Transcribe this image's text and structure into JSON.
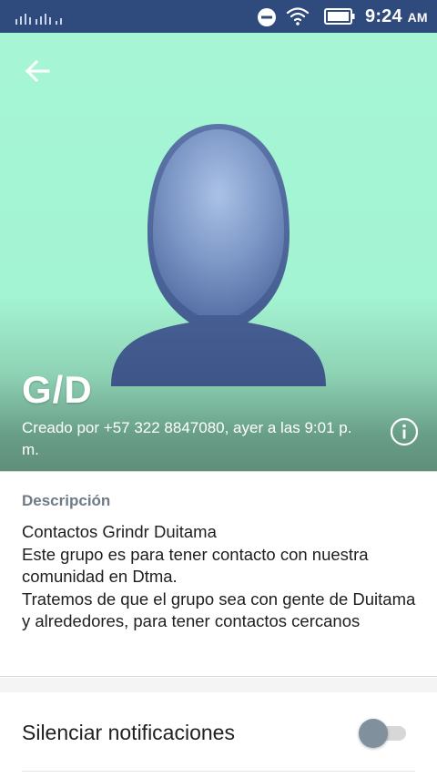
{
  "status_bar": {
    "time": "9:24",
    "ampm": "AM",
    "icons": [
      "signal-icon",
      "do-not-disturb-icon",
      "wifi-icon",
      "battery-icon"
    ]
  },
  "header": {
    "back_icon": "arrow-left-icon",
    "avatar_icon": "person-silhouette-icon",
    "group_name": "G/D",
    "created_by": "Creado por +57 322 8847080, ayer a las 9:01 p. m.",
    "info_icon": "info-icon",
    "colors": {
      "background_top": "#a6f6d6",
      "background_bottom": "#5f8f7b",
      "avatar": "#4e6aa2"
    }
  },
  "description": {
    "title": "Descripción",
    "body": "Contactos Grindr Duitama\nEste grupo es para tener contacto con nuestra comunidad en Dtma.\nTratemos de que el grupo sea con gente de Duitama y alrededores, para tener contactos cercanos"
  },
  "settings": {
    "mute_label": "Silenciar notificaciones",
    "mute_enabled": false
  }
}
